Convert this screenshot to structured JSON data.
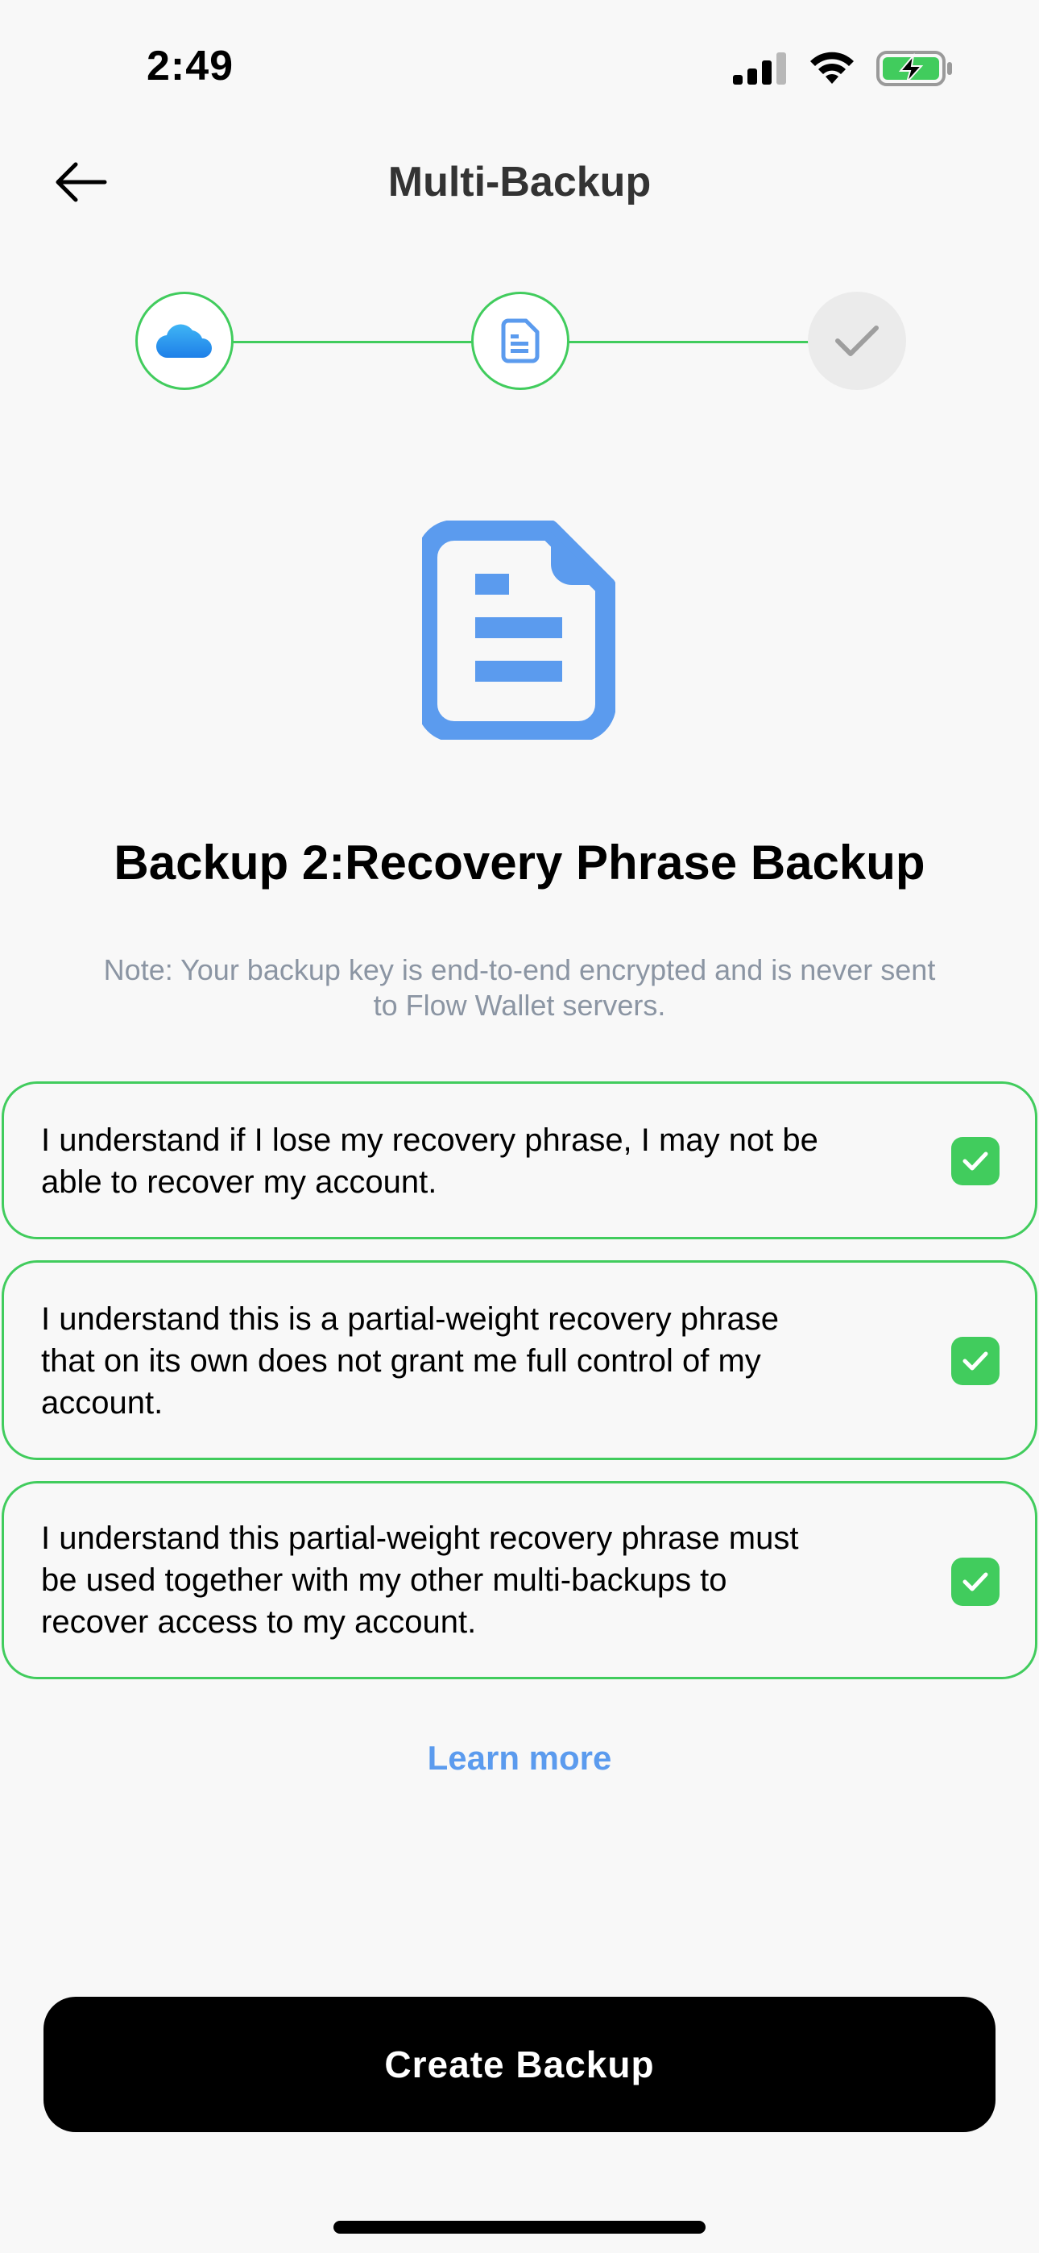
{
  "status": {
    "time": "2:49"
  },
  "nav": {
    "title": "Multi-Backup"
  },
  "stepper": {
    "steps": [
      {
        "icon": "icloud-icon",
        "state": "done"
      },
      {
        "icon": "document-icon",
        "state": "current"
      },
      {
        "icon": "checkmark-icon",
        "state": "pending"
      }
    ],
    "active_color": "#41CC5D"
  },
  "headline": "Backup 2:Recovery Phrase Backup",
  "note": "Note: Your backup key is end-to-end encrypted and is never sent to Flow Wallet servers.",
  "checklist": [
    {
      "text": "I understand if I lose my recovery phrase, I may not be able to recover my account.",
      "checked": true
    },
    {
      "text": "I understand this is a partial-weight recovery phrase that on its own does not grant me full control of my account.",
      "checked": true
    },
    {
      "text": "I understand this partial-weight recovery phrase must be used together with my other multi-backups to recover access to my account.",
      "checked": true
    }
  ],
  "learn_more": "Learn more",
  "cta": {
    "label": "Create Backup"
  },
  "colors": {
    "accent_green": "#41CC5D",
    "accent_blue": "#5B9BEE",
    "background": "#F8F8F8"
  }
}
